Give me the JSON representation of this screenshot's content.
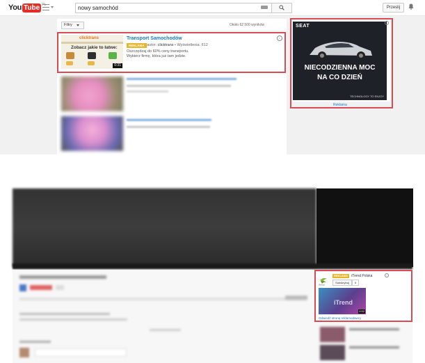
{
  "topbar": {
    "logo_you": "You",
    "logo_tube": "Tube",
    "logo_region": "PL",
    "search_value": "nowy samochód",
    "signin_label": "Przeslij"
  },
  "results": {
    "filter_label": "Filtry",
    "count_text": "Około 62 500 wyników"
  },
  "ad_result": {
    "thumb_brand": "clicktrans",
    "thumb_headline": "Zobacz jakie to łatwe:",
    "duration": "0:31",
    "title": "Transport Samochodów",
    "badge": "REKLAMA",
    "author_prefix": "autor:",
    "author": "clicktrans",
    "views": "Wyświetlenia: 612",
    "desc_line1": "Oszczędzaj do 60% ceny transportu.",
    "desc_line2": "Wybierz firmę, która już tam jedzie."
  },
  "sidebar_ad": {
    "brand": "SEAT",
    "headline_line1": "NIECODZIENNA MOC",
    "headline_line2": "NA CO DZIEŃ",
    "tagline": "TECHNOLOGY TO ENJOY",
    "link": "Reklama"
  },
  "promo": {
    "badge": "REKLAMA",
    "channel": "iTrend Polska",
    "subscribe_label": "Subskrybuj",
    "subscribe_count": "5",
    "logo_text": "iTrend",
    "thumb_word": "iTrend",
    "duration": "0:52",
    "link": "Odwiedź stronę reklamodawcy"
  },
  "colors": {
    "accent_red": "#d94a52",
    "link_blue": "#167ac6",
    "ad_badge": "#e6b72e",
    "youtube_red": "#e52d27"
  }
}
